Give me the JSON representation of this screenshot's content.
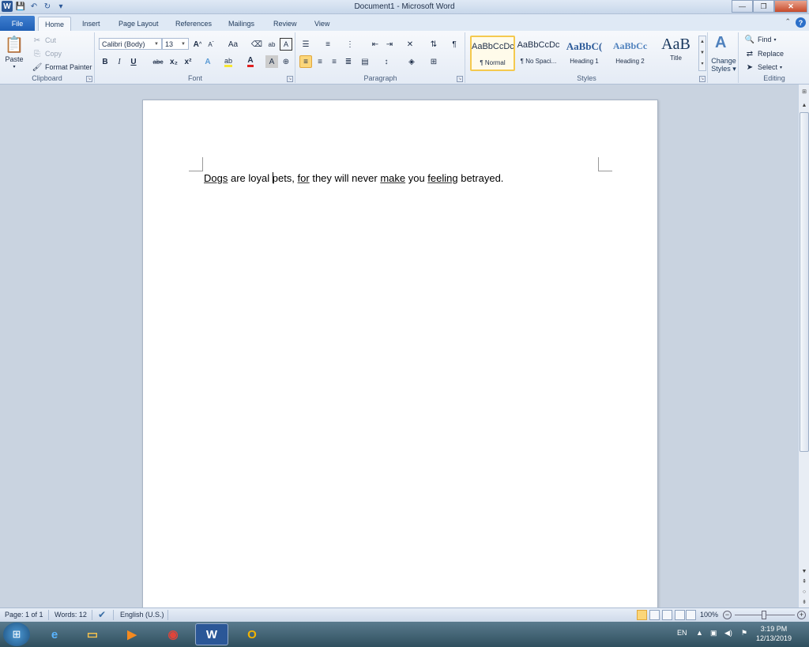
{
  "window": {
    "title": "Document1 - Microsoft Word",
    "minimize_icon": "minimize-icon",
    "restore_icon": "restore-icon",
    "close_icon": "close-icon"
  },
  "quick_access": {
    "app_icon": "W",
    "save_icon": "save-icon",
    "undo_icon": "undo-icon",
    "redo_icon": "redo-icon"
  },
  "tabs": {
    "file": "File",
    "items": [
      "Home",
      "Insert",
      "Page Layout",
      "References",
      "Mailings",
      "Review",
      "View"
    ],
    "active": "Home"
  },
  "clipboard": {
    "paste": "Paste",
    "cut": "Cut",
    "copy": "Copy",
    "format_painter": "Format Painter",
    "label": "Clipboard"
  },
  "font": {
    "name": "Calibri (Body)",
    "size": "13",
    "grow": "A",
    "shrink": "A",
    "case": "Aa",
    "bold": "B",
    "italic": "I",
    "underline": "U",
    "strike": "abc",
    "subscript": "x₂",
    "superscript": "x²",
    "label": "Font"
  },
  "paragraph": {
    "label": "Paragraph",
    "pilcrow": "¶"
  },
  "styles": {
    "label": "Styles",
    "items": [
      {
        "sample": "AaBbCcDc",
        "name": "¶ Normal"
      },
      {
        "sample": "AaBbCcDc",
        "name": "¶ No Spaci..."
      },
      {
        "sample": "AaBbC(",
        "name": "Heading 1"
      },
      {
        "sample": "AaBbCc",
        "name": "Heading 2"
      },
      {
        "sample": "AaB",
        "name": "Title"
      }
    ],
    "change_styles_1": "Change",
    "change_styles_2": "Styles"
  },
  "editing": {
    "find": "Find",
    "replace": "Replace",
    "select": "Select",
    "label": "Editing"
  },
  "document": {
    "w1": "Dogs",
    "w2": " are loyal ",
    "w3": "pets,",
    "w4": " ",
    "w5": "for",
    "w6": " they will never ",
    "w7": "make",
    "w8": " you ",
    "w9": "feeling",
    "w10": " betrayed."
  },
  "status": {
    "page": "Page: 1 of 1",
    "words": "Words: 12",
    "language": "English (U.S.)",
    "zoom": "100%",
    "zoom_level": 1.0
  },
  "taskbar": {
    "apps": [
      "start-icon",
      "ie-icon",
      "explorer-icon",
      "media-player-icon",
      "chrome-icon",
      "word-icon",
      "outlook-icon"
    ],
    "active_app": "word-icon",
    "lang": "EN",
    "time": "3:19 PM",
    "date": "12/13/2019"
  }
}
